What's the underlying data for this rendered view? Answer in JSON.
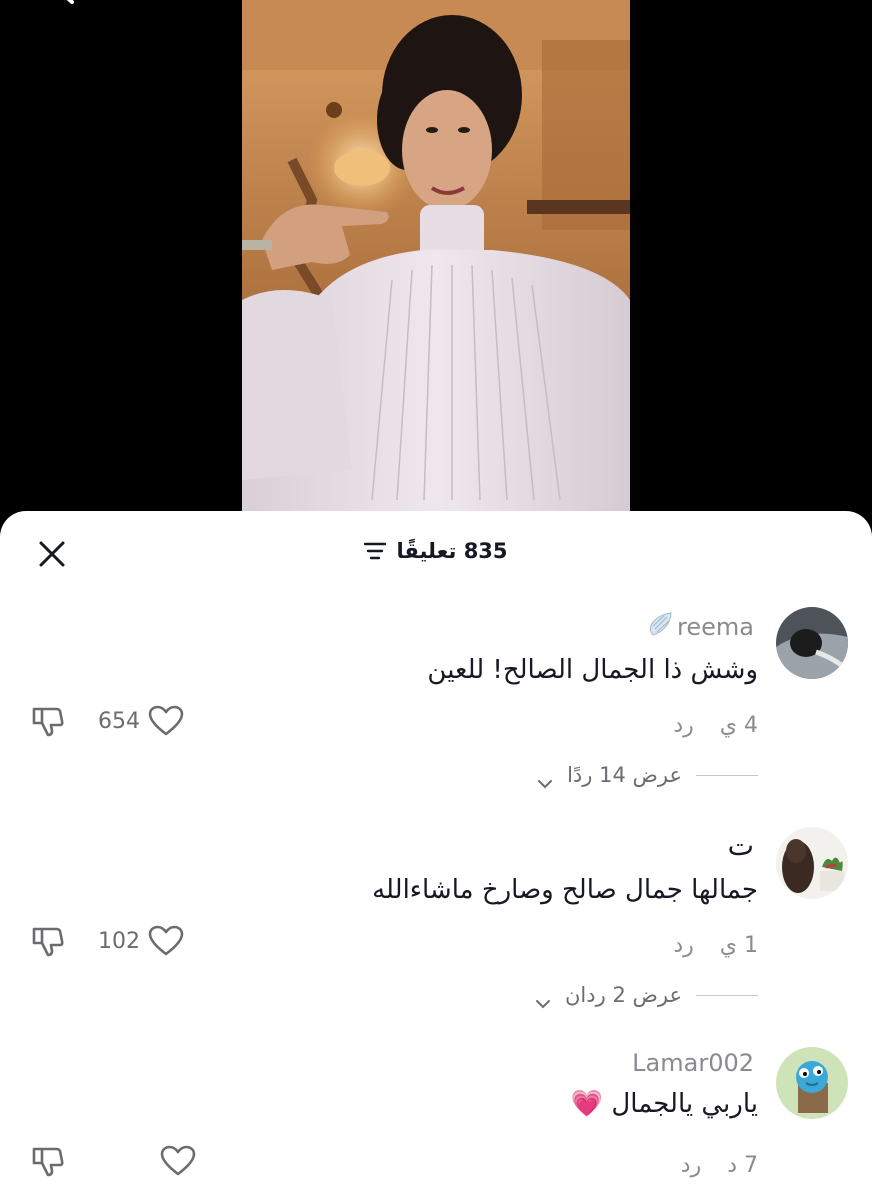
{
  "header": {
    "comment_count_label": "835 تعليقًا"
  },
  "comments": [
    {
      "username": "reema",
      "username_emoji": "wing-icon",
      "text": "وشش ذا الجمال الصالح! للعين",
      "time": "4 ي",
      "reply_label": "رد",
      "likes": "654",
      "view_replies_label": "عرض 14 ردًا"
    },
    {
      "username": "ت",
      "text": "جمالها جمال صالح وصارخ ماشاءالله",
      "time": "1 ي",
      "reply_label": "رد",
      "likes": "102",
      "view_replies_label": "عرض 2 ردان"
    },
    {
      "username": "Lamar002",
      "text": "ياربي يالجمال 💗",
      "time": "7 د",
      "reply_label": "رد",
      "likes": ""
    }
  ],
  "colors": {
    "text_primary": "#161823",
    "text_secondary": "#8a8b91",
    "sheet_background": "#ffffff",
    "screen_background": "#000000"
  }
}
